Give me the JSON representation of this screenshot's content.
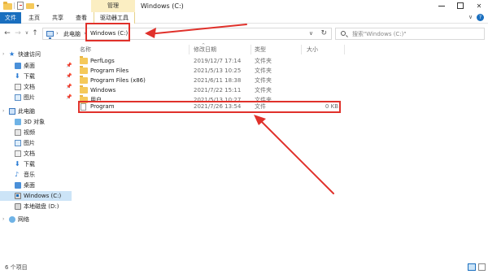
{
  "window": {
    "title": "Windows (C:)",
    "manage_tab": "管理",
    "min_label": "—",
    "close_label": "✕",
    "help_label": "?"
  },
  "ribbon": {
    "tabs": [
      "文件",
      "主页",
      "共享",
      "查看",
      "驱动器工具"
    ]
  },
  "address": {
    "back": "←",
    "forward": "→",
    "recent": "∨",
    "up": "↑",
    "separator": "›",
    "crumbs": [
      "此电脑",
      "Windows (C:)"
    ],
    "dropdown": "∨",
    "refresh": "↻"
  },
  "search": {
    "placeholder": "搜索\"Windows (C:)\""
  },
  "sidebar": {
    "items": [
      {
        "label": "快速访问",
        "chevron": "›"
      },
      {
        "label": "桌面",
        "pin": "📌"
      },
      {
        "label": "下载",
        "pin": "📌"
      },
      {
        "label": "文档",
        "pin": "📌"
      },
      {
        "label": "图片",
        "pin": "📌"
      },
      {
        "label": "此电脑",
        "chevron": "›"
      },
      {
        "label": "3D 对象"
      },
      {
        "label": "视频"
      },
      {
        "label": "图片"
      },
      {
        "label": "文档"
      },
      {
        "label": "下载"
      },
      {
        "label": "音乐"
      },
      {
        "label": "桌面"
      },
      {
        "label": "Windows (C:)"
      },
      {
        "label": "本地磁盘 (D:)"
      },
      {
        "label": "网络",
        "chevron": "›"
      }
    ],
    "selected_index": 13
  },
  "filelist": {
    "sort_indicator": "^",
    "columns": {
      "name": "名称",
      "date": "修改日期",
      "type": "类型",
      "size": "大小"
    },
    "rows": [
      {
        "name": "PerfLogs",
        "date": "2019/12/7 17:14",
        "type": "文件夹",
        "size": "",
        "kind": "folder"
      },
      {
        "name": "Program Files",
        "date": "2021/5/13 10:25",
        "type": "文件夹",
        "size": "",
        "kind": "folder"
      },
      {
        "name": "Program Files (x86)",
        "date": "2021/6/11 18:38",
        "type": "文件夹",
        "size": "",
        "kind": "folder"
      },
      {
        "name": "Windows",
        "date": "2021/7/22 15:11",
        "type": "文件夹",
        "size": "",
        "kind": "folder"
      },
      {
        "name": "用户",
        "date": "2021/5/13 10:27",
        "type": "文件夹",
        "size": "",
        "kind": "folder"
      },
      {
        "name": "Program",
        "date": "2021/7/26 13:54",
        "type": "文件",
        "size": "0 KB",
        "kind": "file"
      }
    ]
  },
  "status": {
    "item_count": "6 个项目"
  },
  "colors": {
    "accent": "#1a6fbf",
    "manage_tab_bg": "#fbeec2",
    "selection_bg": "#cce4f7",
    "annotation_red": "#e0312b",
    "folder_yellow": "#f5c95a"
  }
}
